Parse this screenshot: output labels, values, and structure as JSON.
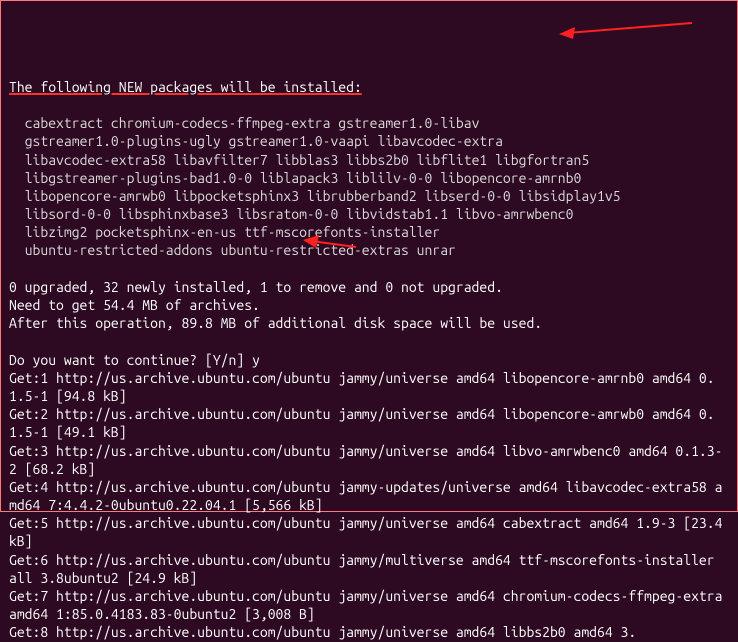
{
  "header": "The following NEW packages will be installed:",
  "packages_block": "  cabextract chromium-codecs-ffmpeg-extra gstreamer1.0-libav\n  gstreamer1.0-plugins-ugly gstreamer1.0-vaapi libavcodec-extra\n  libavcodec-extra58 libavfilter7 libblas3 libbs2b0 libflite1 libgfortran5\n  libgstreamer-plugins-bad1.0-0 liblapack3 liblilv-0-0 libopencore-amrnb0\n  libopencore-amrwb0 libpocketsphinx3 librubberband2 libserd-0-0 libsidplay1v5\n  libsord-0-0 libsphinxbase3 libsratom-0-0 libvidstab1.1 libvo-amrwbenc0\n  libzimg2 pocketsphinx-en-us ttf-mscorefonts-installer\n  ubuntu-restricted-addons ubuntu-restricted-extras unrar",
  "summary": "0 upgraded, 32 newly installed, 1 to remove and 0 not upgraded.\nNeed to get 54.4 MB of archives.\nAfter this operation, 89.8 MB of additional disk space will be used.",
  "prompt_text": "Do you want to continue? [Y/n] ",
  "prompt_input": "y",
  "downloads": "Get:1 http://us.archive.ubuntu.com/ubuntu jammy/universe amd64 libopencore-amrnb0 amd64 0.1.5-1 [94.8 kB]\nGet:2 http://us.archive.ubuntu.com/ubuntu jammy/universe amd64 libopencore-amrwb0 amd64 0.1.5-1 [49.1 kB]\nGet:3 http://us.archive.ubuntu.com/ubuntu jammy/universe amd64 libvo-amrwbenc0 amd64 0.1.3-2 [68.2 kB]\nGet:4 http://us.archive.ubuntu.com/ubuntu jammy-updates/universe amd64 libavcodec-extra58 amd64 7:4.4.2-0ubuntu0.22.04.1 [5,566 kB]\nGet:5 http://us.archive.ubuntu.com/ubuntu jammy/universe amd64 cabextract amd64 1.9-3 [23.4 kB]\nGet:6 http://us.archive.ubuntu.com/ubuntu jammy/multiverse amd64 ttf-mscorefonts-installer all 3.8ubuntu2 [24.9 kB]\nGet:7 http://us.archive.ubuntu.com/ubuntu jammy/universe amd64 chromium-codecs-ffmpeg-extra amd64 1:85.0.4183.83-0ubuntu2 [3,008 B]\nGet:8 http://us.archive.ubuntu.com/ubuntu jammy/universe amd64 libbs2b0 amd64 3."
}
